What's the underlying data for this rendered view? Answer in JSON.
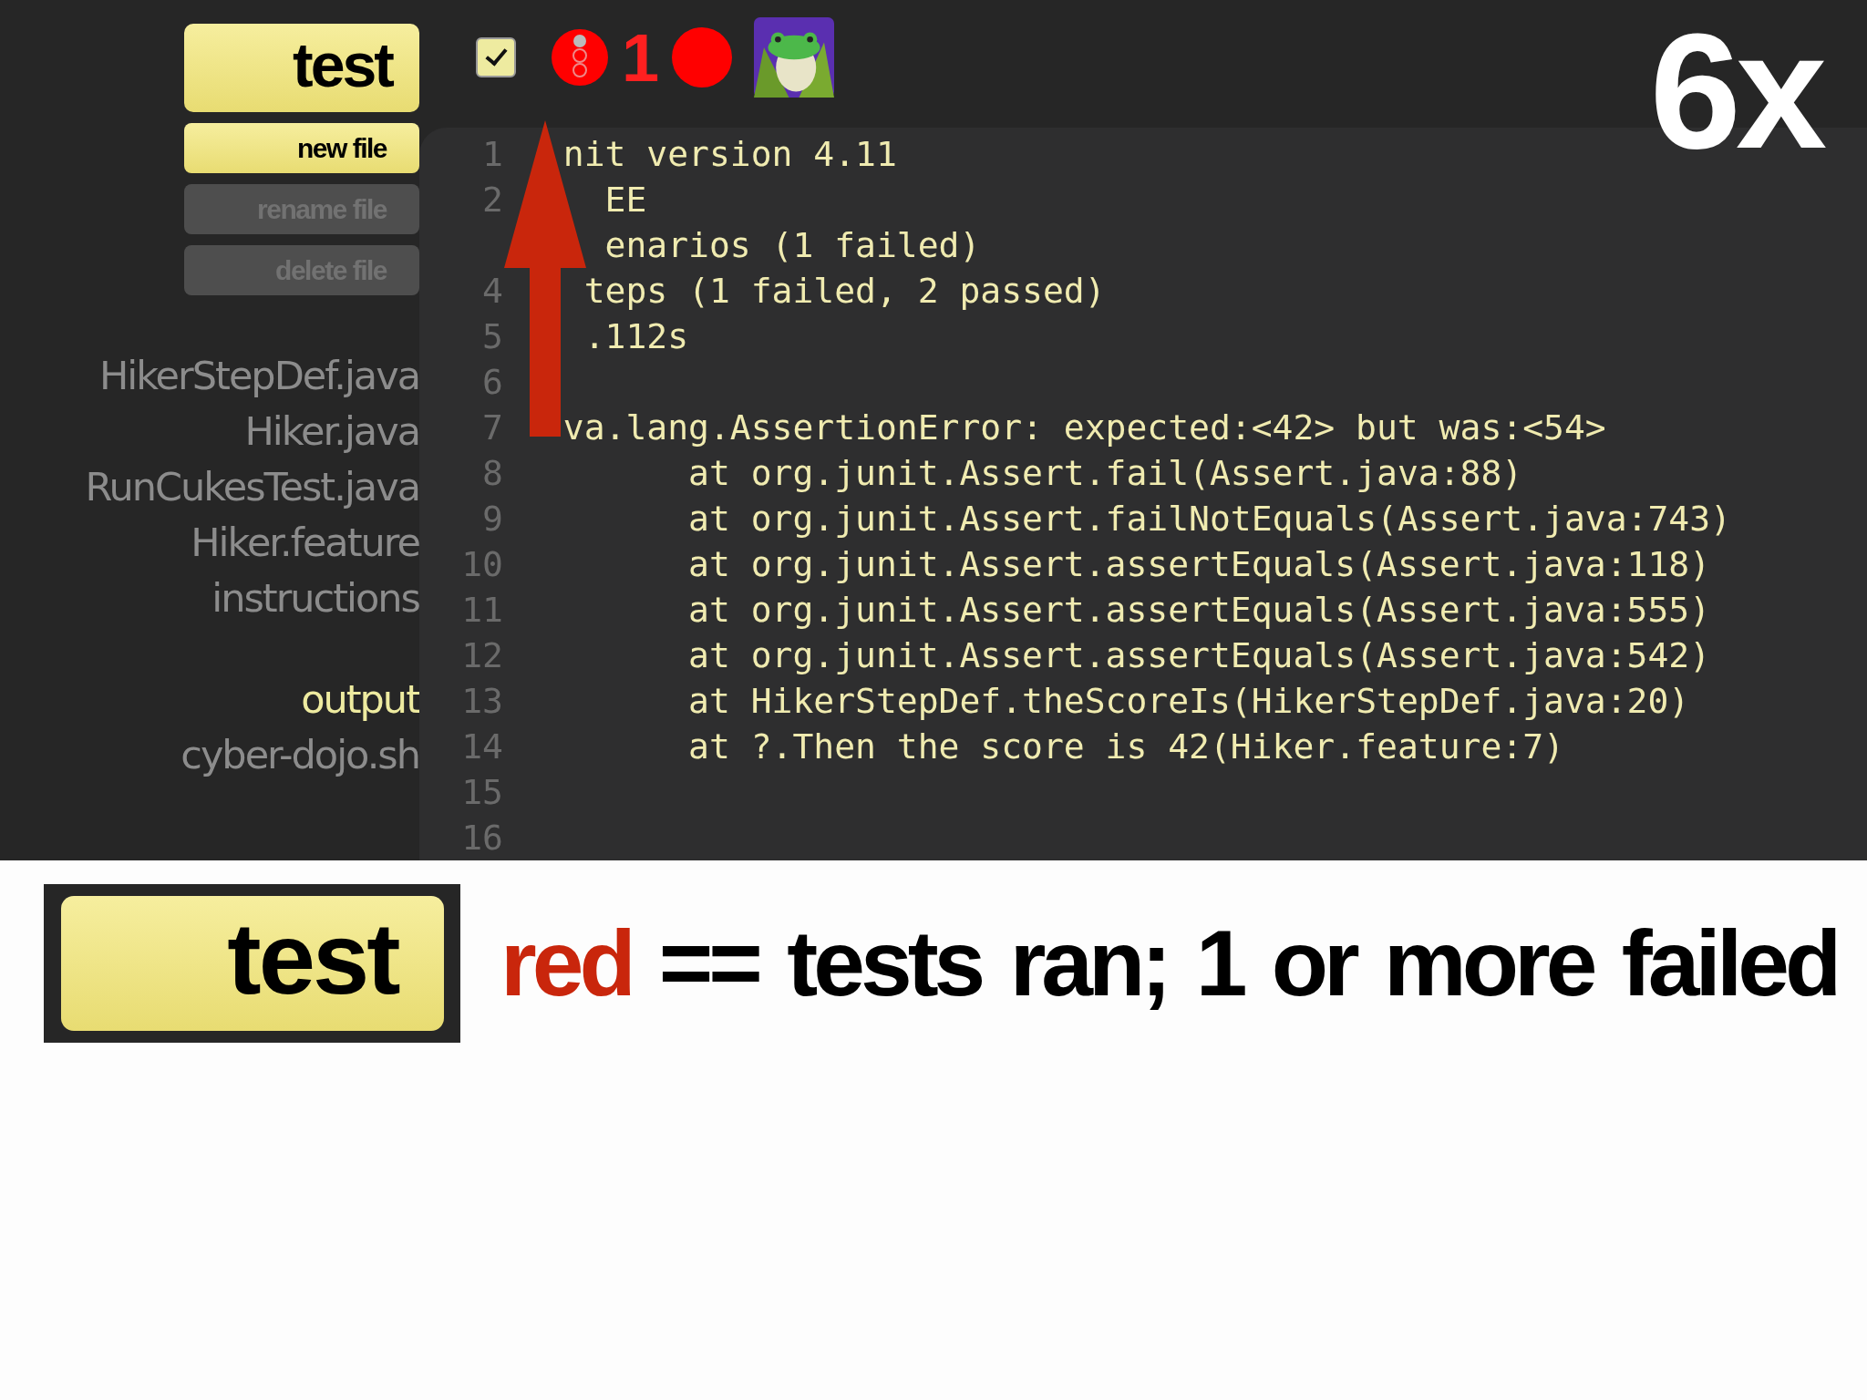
{
  "badge": "6x",
  "toolbar": {
    "test_button": "test",
    "auto_checked": true,
    "traffic_light": {
      "color": "#ff0000"
    },
    "count": "1",
    "status_dot": {
      "color": "#ff0000"
    }
  },
  "file_buttons": [
    {
      "label": "new file",
      "disabled": false
    },
    {
      "label": "rename file",
      "disabled": true
    },
    {
      "label": "delete file",
      "disabled": true
    }
  ],
  "files": [
    {
      "name": "HikerStepDef.java",
      "selected": false
    },
    {
      "name": "Hiker.java",
      "selected": false
    },
    {
      "name": "RunCukesTest.java",
      "selected": false
    },
    {
      "name": "Hiker.feature",
      "selected": false
    },
    {
      "name": "instructions",
      "selected": false
    },
    {
      "name": "output",
      "selected": true
    },
    {
      "name": "cyber-dojo.sh",
      "selected": false
    }
  ],
  "output_lines": [
    {
      "num": "1",
      "parts": [
        "nit version 4.11"
      ]
    },
    {
      "num": "2",
      "parts": [
        "EE"
      ]
    },
    {
      "parts": [
        "enarios (1 failed)"
      ]
    },
    {
      "num": "4",
      "parts": [
        "teps (1 failed, 2 passed)"
      ]
    },
    {
      "num": "5",
      "parts": [
        ".112s"
      ]
    },
    {
      "num": "6"
    },
    {
      "num": "7",
      "parts": [
        "va.lang.AssertionError: expected:<42> but was:<54>"
      ]
    },
    {
      "num": "8",
      "parts": [
        "\tat org.junit.Assert.fail(Assert.java:88)"
      ]
    },
    {
      "num": "9",
      "parts": [
        "\tat org.junit.Assert.failNotEquals(Assert.java:743)"
      ]
    },
    {
      "num": "10",
      "parts": [
        "\tat org.junit.Assert.assertEquals(Assert.java:118)"
      ]
    },
    {
      "num": "11",
      "parts": [
        "\tat org.junit.Assert.assertEquals(Assert.java:555)"
      ]
    },
    {
      "num": "12",
      "parts": [
        "\tat org.junit.Assert.assertEquals(Assert.java:542)"
      ]
    },
    {
      "num": "13",
      "parts": [
        "\tat HikerStepDef.theScoreIs(HikerStepDef.java:20)"
      ]
    },
    {
      "num": "14",
      "parts": [
        "\tat ?.Then the score is 42(Hiker.feature:7)"
      ]
    },
    {
      "num": "15"
    },
    {
      "num": "16"
    }
  ],
  "legend": {
    "button": "test",
    "keyword": "red",
    "text": "== tests ran; 1 or more failed"
  }
}
